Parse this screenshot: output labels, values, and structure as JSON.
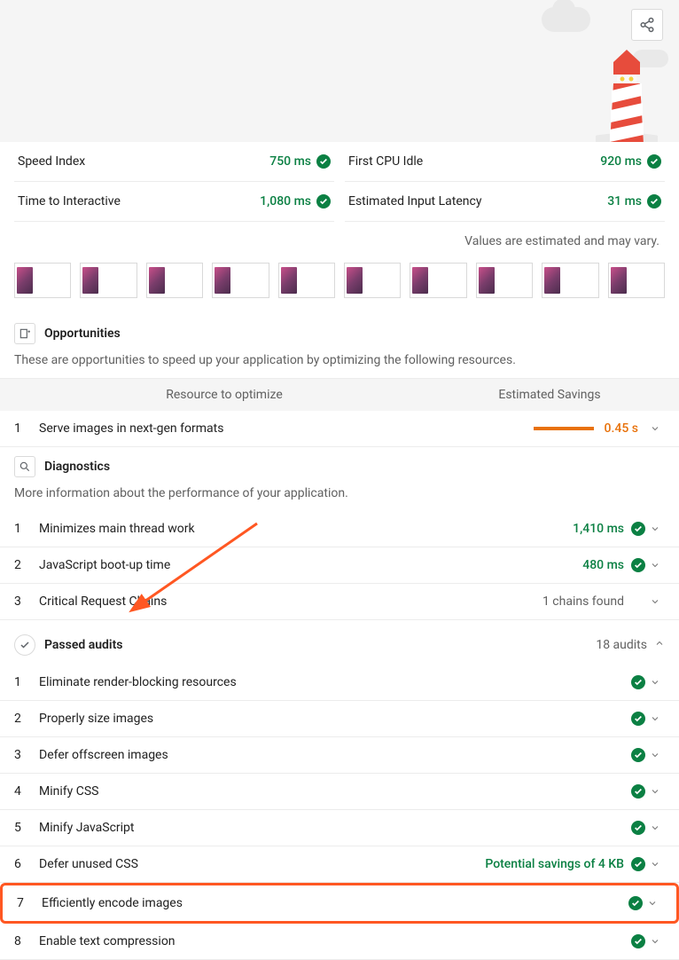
{
  "metrics": {
    "left": [
      {
        "name": "Speed Index",
        "value": "750 ms"
      },
      {
        "name": "Time to Interactive",
        "value": "1,080 ms"
      }
    ],
    "right": [
      {
        "name": "First CPU Idle",
        "value": "920 ms"
      },
      {
        "name": "Estimated Input Latency",
        "value": "31 ms"
      }
    ]
  },
  "estimated_note": "Values are estimated and may vary.",
  "opportunities": {
    "title": "Opportunities",
    "desc": "These are opportunities to speed up your application by optimizing the following resources.",
    "col1": "Resource to optimize",
    "col2": "Estimated Savings",
    "items": [
      {
        "idx": "1",
        "label": "Serve images in next-gen formats",
        "value": "0.45 s"
      }
    ]
  },
  "diagnostics": {
    "title": "Diagnostics",
    "desc": "More information about the performance of your application.",
    "items": [
      {
        "idx": "1",
        "label": "Minimizes main thread work",
        "value": "1,410 ms",
        "status": "pass"
      },
      {
        "idx": "2",
        "label": "JavaScript boot-up time",
        "value": "480 ms",
        "status": "pass"
      },
      {
        "idx": "3",
        "label": "Critical Request Chains",
        "value": "1 chains found",
        "status": "info"
      }
    ]
  },
  "passed": {
    "title": "Passed audits",
    "count": "18 audits",
    "items": [
      {
        "idx": "1",
        "label": "Eliminate render-blocking resources",
        "value": ""
      },
      {
        "idx": "2",
        "label": "Properly size images",
        "value": ""
      },
      {
        "idx": "3",
        "label": "Defer offscreen images",
        "value": ""
      },
      {
        "idx": "4",
        "label": "Minify CSS",
        "value": ""
      },
      {
        "idx": "5",
        "label": "Minify JavaScript",
        "value": ""
      },
      {
        "idx": "6",
        "label": "Defer unused CSS",
        "value": "Potential savings of 4 KB"
      },
      {
        "idx": "7",
        "label": "Efficiently encode images",
        "value": "",
        "highlight": true
      },
      {
        "idx": "8",
        "label": "Enable text compression",
        "value": ""
      }
    ]
  }
}
